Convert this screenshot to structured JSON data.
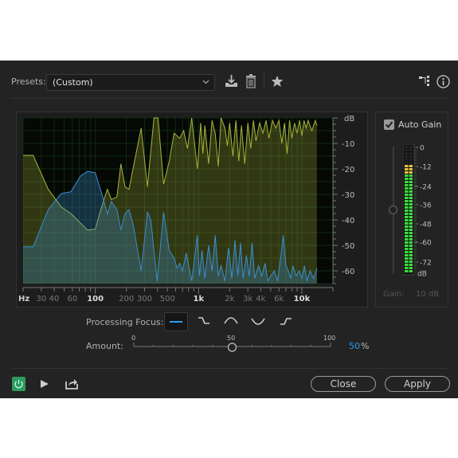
{
  "toolbar": {
    "presets_label": "Presets:",
    "preset_value": "(Custom)",
    "icons": [
      "save-preset-icon",
      "delete-preset-icon",
      "favorite-star-icon",
      "routing-icon",
      "info-icon"
    ]
  },
  "auto_gain": {
    "label": "Auto Gain",
    "checked": true,
    "meter_labels": [
      "0",
      "-12",
      "-24",
      "-36",
      "-48",
      "-60",
      "-72",
      "dB"
    ],
    "gain_label": "Gain:",
    "gain_value": "10 dB"
  },
  "processing_focus": {
    "label": "Processing Focus:",
    "options": [
      "flat-icon",
      "low-shelf-icon",
      "mid-bell-icon",
      "mid-notch-icon",
      "high-shelf-icon"
    ],
    "selected": 0
  },
  "amount": {
    "label": "Amount:",
    "tick_min": "0",
    "tick_mid": "50",
    "tick_max": "100",
    "value": "50",
    "unit": "%",
    "value_num": 50
  },
  "footer": {
    "close_label": "Close",
    "apply_label": "Apply"
  },
  "colors": {
    "accent": "#2d9bf0",
    "power_on": "#2e9a5e",
    "series_yellow": "#a8b43a",
    "series_blue": "#3a8fd0",
    "meter_green": "#3fdc3f",
    "meter_yellow": "#e8c040"
  },
  "chart_data": {
    "type": "area",
    "x_scale": "log",
    "xlim": [
      20,
      20000
    ],
    "ylim": [
      -65,
      0
    ],
    "grid": true,
    "x_unit_label": "Hz",
    "y_unit_label": "dB",
    "x_ticks": [
      {
        "v": 30,
        "t": "30",
        "bold": false
      },
      {
        "v": 40,
        "t": "40",
        "bold": false
      },
      {
        "v": 60,
        "t": "60",
        "bold": false
      },
      {
        "v": 100,
        "t": "100",
        "bold": true
      },
      {
        "v": 200,
        "t": "200",
        "bold": false
      },
      {
        "v": 300,
        "t": "300",
        "bold": false
      },
      {
        "v": 500,
        "t": "500",
        "bold": false
      },
      {
        "v": 1000,
        "t": "1k",
        "bold": true
      },
      {
        "v": 2000,
        "t": "2k",
        "bold": false
      },
      {
        "v": 3000,
        "t": "3k",
        "bold": false
      },
      {
        "v": 4000,
        "t": "4k",
        "bold": false
      },
      {
        "v": 6000,
        "t": "6k",
        "bold": false
      },
      {
        "v": 10000,
        "t": "10k",
        "bold": true
      }
    ],
    "y_ticks": [
      {
        "v": -10,
        "t": "-10"
      },
      {
        "v": -20,
        "t": "-20"
      },
      {
        "v": -30,
        "t": "-30"
      },
      {
        "v": -40,
        "t": "-40"
      },
      {
        "v": -50,
        "t": "-50"
      },
      {
        "v": -60,
        "t": "-60"
      }
    ],
    "series": [
      {
        "color": "#a8b43a",
        "points": [
          [
            20,
            -14.7
          ],
          [
            25,
            -14.7
          ],
          [
            35,
            -28
          ],
          [
            47,
            -35
          ],
          [
            58,
            -37.5
          ],
          [
            84,
            -44
          ],
          [
            100,
            -43.7
          ],
          [
            115,
            -35
          ],
          [
            131,
            -28
          ],
          [
            143,
            -32
          ],
          [
            162,
            -31
          ],
          [
            177,
            -18
          ],
          [
            194,
            -27
          ],
          [
            212,
            -28
          ],
          [
            232,
            -20
          ],
          [
            278,
            -4
          ],
          [
            320,
            -27
          ],
          [
            370,
            0
          ],
          [
            405,
            0
          ],
          [
            459,
            -26
          ],
          [
            520,
            -17
          ],
          [
            579,
            -6
          ],
          [
            656,
            -8
          ],
          [
            718,
            -5
          ],
          [
            780,
            -12
          ],
          [
            859,
            0
          ],
          [
            973,
            -20
          ],
          [
            1050,
            -2
          ],
          [
            1100,
            -14
          ],
          [
            1150,
            -3
          ],
          [
            1250,
            -18
          ],
          [
            1350,
            -1
          ],
          [
            1450,
            -6
          ],
          [
            1550,
            -19
          ],
          [
            1650,
            0
          ],
          [
            1800,
            -4
          ],
          [
            1900,
            -11
          ],
          [
            2000,
            -2
          ],
          [
            2150,
            -15
          ],
          [
            2300,
            -1
          ],
          [
            2450,
            -17
          ],
          [
            2600,
            -3
          ],
          [
            2800,
            -18
          ],
          [
            3000,
            -2
          ],
          [
            3200,
            -12
          ],
          [
            3400,
            -1
          ],
          [
            3600,
            -9
          ],
          [
            3900,
            -2
          ],
          [
            4200,
            -6
          ],
          [
            4500,
            -1
          ],
          [
            4800,
            -8
          ],
          [
            5200,
            -1
          ],
          [
            5600,
            -4
          ],
          [
            6000,
            -1
          ],
          [
            6400,
            -10
          ],
          [
            6800,
            -2
          ],
          [
            7200,
            -14
          ],
          [
            7600,
            -1
          ],
          [
            8000,
            -8
          ],
          [
            8500,
            -2
          ],
          [
            9000,
            -6
          ],
          [
            9500,
            -1
          ],
          [
            10000,
            -7
          ],
          [
            10500,
            -1
          ],
          [
            11000,
            -4
          ],
          [
            11500,
            -1
          ],
          [
            12500,
            -5
          ],
          [
            13500,
            -1
          ],
          [
            14000,
            -3
          ]
        ]
      },
      {
        "color": "#3a8fd0",
        "points": [
          [
            20,
            -50.6
          ],
          [
            25,
            -50.6
          ],
          [
            35,
            -36
          ],
          [
            47,
            -29.7
          ],
          [
            58,
            -29
          ],
          [
            72,
            -22.8
          ],
          [
            84,
            -21
          ],
          [
            100,
            -21.5
          ],
          [
            120,
            -32
          ],
          [
            131,
            -37.8
          ],
          [
            143,
            -32.8
          ],
          [
            162,
            -36
          ],
          [
            177,
            -44
          ],
          [
            194,
            -37.5
          ],
          [
            212,
            -36
          ],
          [
            232,
            -41.6
          ],
          [
            278,
            -60
          ],
          [
            320,
            -37
          ],
          [
            345,
            -40
          ],
          [
            397,
            -64
          ],
          [
            459,
            -37
          ],
          [
            520,
            -52
          ],
          [
            579,
            -55
          ],
          [
            620,
            -59
          ],
          [
            656,
            -57
          ],
          [
            700,
            -60
          ],
          [
            760,
            -53
          ],
          [
            859,
            -64
          ],
          [
            973,
            -46
          ],
          [
            1020,
            -62
          ],
          [
            1080,
            -52
          ],
          [
            1150,
            -63
          ],
          [
            1250,
            -50
          ],
          [
            1350,
            -60
          ],
          [
            1450,
            -46
          ],
          [
            1550,
            -62
          ],
          [
            1650,
            -58
          ],
          [
            1800,
            -64
          ],
          [
            1950,
            -51
          ],
          [
            2100,
            -63
          ],
          [
            2250,
            -48
          ],
          [
            2400,
            -62
          ],
          [
            2550,
            -49
          ],
          [
            2700,
            -63
          ],
          [
            2900,
            -54
          ],
          [
            3100,
            -62
          ],
          [
            3300,
            -49
          ],
          [
            3500,
            -63
          ],
          [
            3800,
            -58
          ],
          [
            4100,
            -62
          ],
          [
            4400,
            -57
          ],
          [
            4700,
            -64
          ],
          [
            5000,
            -62
          ],
          [
            5400,
            -60
          ],
          [
            5800,
            -64
          ],
          [
            6200,
            -56
          ],
          [
            6600,
            -46
          ],
          [
            7000,
            -58
          ],
          [
            7400,
            -60
          ],
          [
            7800,
            -63
          ],
          [
            8200,
            -58
          ],
          [
            8800,
            -62
          ],
          [
            9400,
            -60
          ],
          [
            10000,
            -63
          ],
          [
            10600,
            -58
          ],
          [
            11200,
            -64
          ],
          [
            12000,
            -60
          ],
          [
            13000,
            -63
          ],
          [
            14000,
            -59
          ]
        ]
      }
    ]
  }
}
